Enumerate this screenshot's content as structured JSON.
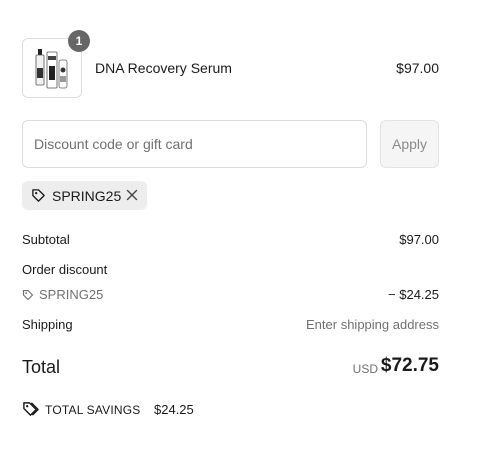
{
  "product": {
    "quantity": "1",
    "name": "DNA Recovery Serum",
    "price": "$97.00",
    "thumbnail_icon": "product-bottles-image"
  },
  "discount_form": {
    "placeholder": "Discount code or gift card",
    "apply_label": "Apply"
  },
  "applied_code": {
    "label": "SPRING25",
    "tag_icon": "tag-icon",
    "remove_icon": "close-icon"
  },
  "summary": {
    "subtotal_label": "Subtotal",
    "subtotal_value": "$97.00",
    "order_discount_label": "Order discount",
    "discount_code": "SPRING25",
    "discount_value": "− $24.25",
    "shipping_label": "Shipping",
    "shipping_value": "Enter shipping address",
    "total_label": "Total",
    "total_currency": "USD",
    "total_value": "$72.75",
    "savings_label": "TOTAL SAVINGS",
    "savings_value": "$24.25"
  },
  "colors": {
    "text": "#1a1a1a",
    "muted": "#707070",
    "badge": "#666666",
    "chip_bg": "#ededed",
    "border": "#dcdcdc"
  }
}
